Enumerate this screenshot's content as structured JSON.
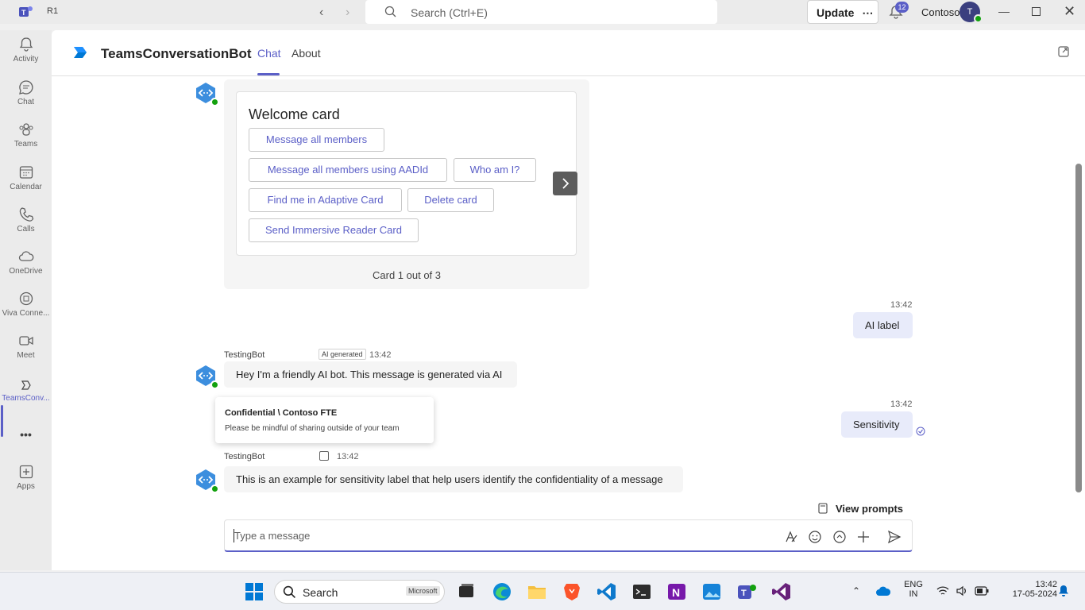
{
  "window": {
    "title": "R1",
    "search_placeholder": "Search (Ctrl+E)",
    "update_label": "Update",
    "update_more": "⋯",
    "notification_count": "12",
    "org": "Contoso",
    "avatar_initials": "T"
  },
  "rail": {
    "items": [
      {
        "label": "Activity"
      },
      {
        "label": "Chat"
      },
      {
        "label": "Teams"
      },
      {
        "label": "Calendar"
      },
      {
        "label": "Calls"
      },
      {
        "label": "OneDrive"
      },
      {
        "label": "Viva Conne..."
      },
      {
        "label": "Meet"
      },
      {
        "label": "TeamsConv..."
      },
      {
        "label": "•••"
      },
      {
        "label": "Apps"
      }
    ]
  },
  "header": {
    "app_name": "TeamsConversationBot",
    "tabs": [
      {
        "label": "Chat"
      },
      {
        "label": "About"
      }
    ]
  },
  "card": {
    "title": "Welcome card",
    "buttons": [
      "Message all members",
      "Message all members using AADId",
      "Who am I?",
      "Find me in Adaptive Card",
      "Delete card",
      "Send Immersive Reader Card"
    ],
    "count": "Card 1 out of 3"
  },
  "messages": {
    "m1": {
      "time": "13:42",
      "text": "AI label"
    },
    "b1": {
      "sender": "TestingBot",
      "badge": "AI generated",
      "time": "13:42",
      "text": "Hey I'm a friendly AI bot. This message is generated via AI"
    },
    "m2": {
      "time": "13:42",
      "text": "Sensitivity"
    },
    "tooltip": {
      "title": "Confidential \\ Contoso FTE",
      "body": "Please be mindful of sharing outside of your team"
    },
    "b2": {
      "sender": "TestingBot",
      "time": "13:42",
      "text": "This is an example for sensitivity label that help users identify the confidentiality of a message"
    }
  },
  "compose": {
    "view_prompts": "View prompts",
    "placeholder": "Type a message"
  },
  "taskbar": {
    "search": "Search",
    "search_badge": "Microsoft",
    "lang": "ENG",
    "region": "IN",
    "time": "13:42",
    "date": "17-05-2024"
  },
  "colors": {
    "accent": "#5b5fc7",
    "presence": "#13a10e"
  }
}
